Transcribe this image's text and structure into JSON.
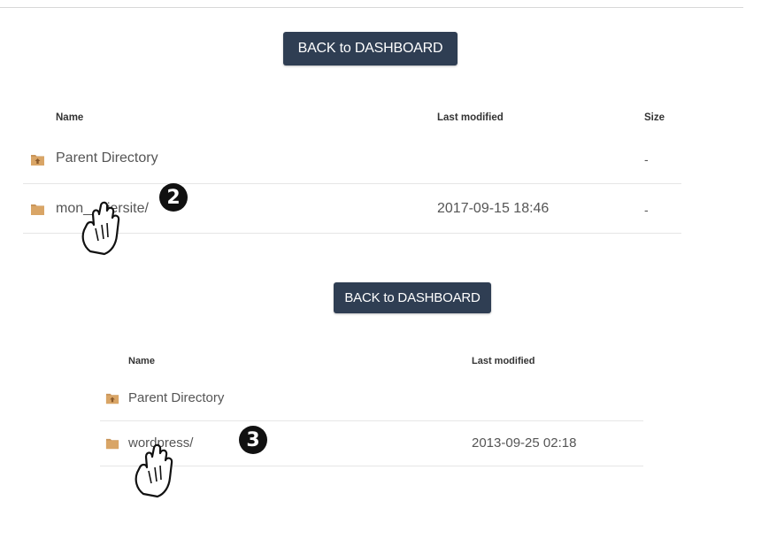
{
  "section1": {
    "back_button": "BACK to DASHBOARD",
    "headers": {
      "name": "Name",
      "last_modified": "Last modified",
      "size": "Size"
    },
    "rows": [
      {
        "name": "Parent Directory",
        "modified": "",
        "size": "-",
        "icon": "parent-folder-icon"
      },
      {
        "name": "mon___iersite/",
        "modified": "2017-09-15 18:46",
        "size": "-",
        "icon": "folder-icon"
      }
    ],
    "step_number": "2"
  },
  "section2": {
    "back_button": "BACK to DASHBOARD",
    "headers": {
      "name": "Name",
      "last_modified": "Last modified"
    },
    "rows": [
      {
        "name": "Parent Directory",
        "modified": "",
        "icon": "parent-folder-icon"
      },
      {
        "name": "wordpress/",
        "modified": "2013-09-25 02:18",
        "icon": "folder-icon"
      }
    ],
    "step_number": "3"
  },
  "colors": {
    "button_bg": "#2f3e53",
    "folder": "#c9955a",
    "text": "#555555"
  }
}
